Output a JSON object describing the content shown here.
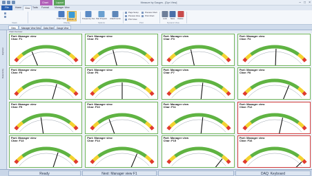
{
  "window": {
    "title": "Measure by Gauges - [Dyn View]",
    "context_tabs": [
      "Chart Tools",
      "Layout"
    ]
  },
  "ribbon": {
    "file_tab": "File",
    "tabs": [
      "Home",
      "View",
      "Tools",
      "Format",
      "Manager View"
    ],
    "active_tab": "View",
    "buttons": [
      {
        "label": "Chart Options",
        "color": "#4a7ac0"
      },
      {
        "label": "Tabular View",
        "color": "#3a9ad6"
      },
      {
        "label": "Frequency Summary",
        "color": "#5a8ac4"
      },
      {
        "label": "Part Properties",
        "color": "#6aa0d0"
      },
      {
        "label": "Attachments",
        "color": "#5d86b8"
      },
      {
        "label": "Lock",
        "color": "#6f7f99"
      },
      {
        "label": "Save",
        "color": "#4a6fa8"
      },
      {
        "label": "Delete",
        "color": "#c84b4b"
      }
    ],
    "small_buttons": [
      "Page Setup",
      "Preview View",
      "Print View",
      "Preview Chart",
      "Print Chart"
    ],
    "groups": [
      "Views",
      "Display",
      "Options",
      "Print",
      "Dynamic View"
    ]
  },
  "doc_tabs": [
    "View",
    "Manager View Setup",
    "Data Sheet",
    "Gauge View"
  ],
  "area_header": "Chart Overview",
  "side_panel": [
    "Explorer",
    "Data Entry"
  ],
  "gauges": [
    {
      "part": "Part: Manager view",
      "char": "Char: F1",
      "value": 0.28,
      "alert": false
    },
    {
      "part": "Part: Manager view",
      "char": "Char: F2",
      "value": 0.36,
      "alert": false
    },
    {
      "part": "Part: Manager view",
      "char": "Char: F3",
      "value": 0.38,
      "alert": false
    },
    {
      "part": "Part: Manager view",
      "char": "Char: F4",
      "value": 0.52,
      "alert": false
    },
    {
      "part": "Part: Manager view",
      "char": "Char: F5",
      "value": 0.66,
      "alert": false
    },
    {
      "part": "Part: Manager view",
      "char": "Char: F6",
      "value": 0.5,
      "alert": false
    },
    {
      "part": "Part: Manager view",
      "char": "Char: F7",
      "value": 0.56,
      "alert": false
    },
    {
      "part": "Part: Manager view",
      "char": "Char: F8",
      "value": 0.72,
      "alert": false
    },
    {
      "part": "Part: Manager view",
      "char": "Char: F9",
      "value": 0.42,
      "alert": false
    },
    {
      "part": "Part: Manager view",
      "char": "Char: F10",
      "value": 0.3,
      "alert": false
    },
    {
      "part": "Part: Manager view",
      "char": "Char: F11",
      "value": 0.56,
      "alert": false
    },
    {
      "part": "Part: Manager view",
      "char": "Char: F12",
      "value": 0.62,
      "alert": true
    },
    {
      "part": "Part: Manager view",
      "char": "Char: F13",
      "value": 0.68,
      "alert": false
    },
    {
      "part": "Part: Manager view",
      "char": "Char: F14",
      "value": 0.73,
      "alert": false
    },
    {
      "part": "Part: Manager view",
      "char": "Char: F15",
      "value": 0.88,
      "alert": false
    },
    {
      "part": "Part: Manager view",
      "char": "Char: F16",
      "value": 0.95,
      "alert": true
    }
  ],
  "status": {
    "ready": "Ready",
    "next": "Next: Manager view F1",
    "middle": "",
    "daq": "DAQ: Keyboard"
  },
  "colors": {
    "ok_border": "#6fb55a",
    "alert_border": "#d03a3a",
    "arc_green": "#5fb342",
    "arc_yellow": "#f2d230",
    "arc_red": "#e03b2e"
  }
}
